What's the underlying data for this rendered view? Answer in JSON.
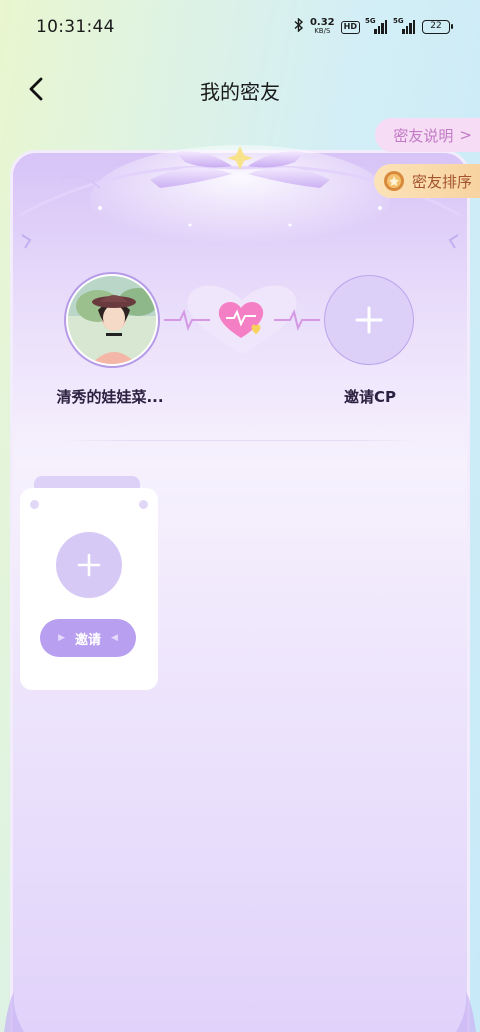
{
  "status_bar": {
    "time": "10:31:44",
    "speed_value": "0.32",
    "speed_unit": "KB/S",
    "hd": "HD",
    "signal1": "5G",
    "signal2": "5G",
    "battery": "22"
  },
  "nav": {
    "title": "我的密友"
  },
  "side_buttons": {
    "explain_label": "密友说明",
    "explain_chevron": ">",
    "rank_label": "密友排序"
  },
  "cp": {
    "user_name": "清秀的娃娃菜...",
    "invite_label": "邀请CP"
  },
  "slot": {
    "invite_button": "邀请"
  },
  "colors": {
    "accent": "#b89ff0",
    "card_top": "#d7c3f7",
    "rank_text": "#a3532e",
    "explain_text": "#c27ac6"
  },
  "icons": [
    "back-arrow-icon",
    "bluetooth-icon",
    "signal-icon",
    "battery-icon",
    "medal-icon",
    "plus-icon",
    "heart-pulse-icon"
  ]
}
